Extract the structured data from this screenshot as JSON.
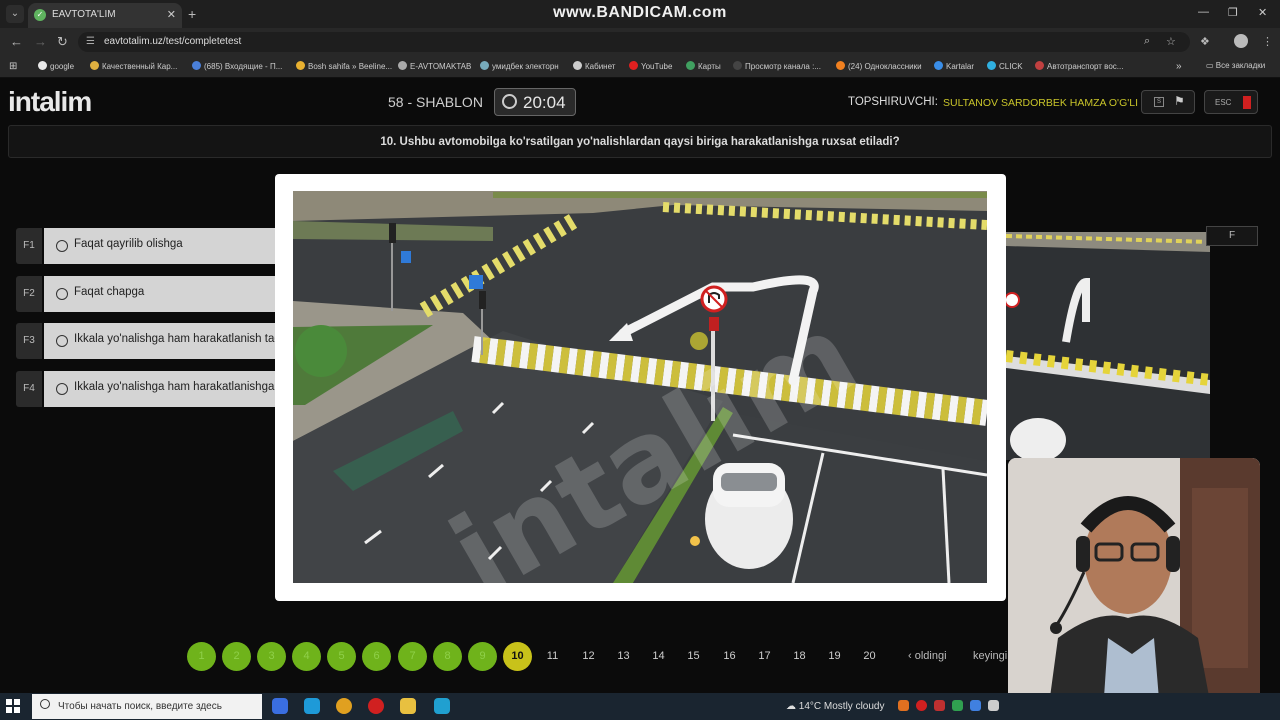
{
  "browser": {
    "tab_title": "EAVTOTA'LIM",
    "recorder_title": "www.BANDICAM.com",
    "url": "eavtotalim.uz/test/completetest",
    "bookmarks": [
      "google",
      "Качественный Кар...",
      "(685) Входящие - П...",
      "Bosh sahifa » Beeline...",
      "E-AVTOMAKTAB",
      "умидбек электорн",
      "Кабинет",
      "YouTube",
      "Карты",
      "Просмотр канала :...",
      "(24) Одноклассники",
      "Kartalar",
      "CLICK",
      "Автотранспорт вос..."
    ],
    "all_bookmarks": "Все закладки"
  },
  "header": {
    "logo": "intalim",
    "shablon": "58 - SHABLON",
    "timer": "20:04",
    "student_label": "TOPSHIRUVCHI:",
    "student_name": "SULTANOV SARDORBEK HAMZA O'G'LI",
    "esc_label": "ESC"
  },
  "question": "10. Ushbu avtomobilga ko'rsatilgan yo'nalishlardan qaysi biriga harakatlanishga ruxsat etiladi?",
  "options": [
    {
      "key": "F1",
      "text": "Faqat qayrilib olishga"
    },
    {
      "key": "F2",
      "text": "Faqat chapga"
    },
    {
      "key": "F3",
      "text": "Ikkala yo'nalishga ham harakatlanish taqiqlanadi"
    },
    {
      "key": "F4",
      "text": "Ikkala yo'nalishga ham harakatlanishga ruxsat etiladi"
    }
  ],
  "side_f": "F",
  "image_watermark": "intalim",
  "pager": {
    "pages": [
      "1",
      "2",
      "3",
      "4",
      "5",
      "6",
      "7",
      "8",
      "9",
      "10",
      "11",
      "12",
      "13",
      "14",
      "15",
      "16",
      "17",
      "18",
      "19",
      "20"
    ],
    "answered_count": 9,
    "current": 10,
    "prev": "‹ oldingi",
    "next": "keyingi"
  },
  "taskbar": {
    "search_placeholder": "Чтобы начать поиск, введите здесь",
    "weather": "14°C  Mostly cloudy"
  },
  "colors": {
    "answered": "#6fb31b",
    "current": "#c8c21a",
    "student_name": "#c9c52a"
  }
}
